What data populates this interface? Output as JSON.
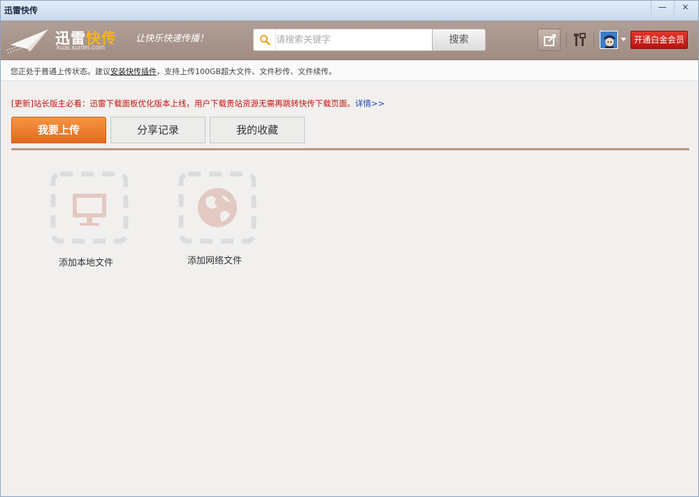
{
  "window": {
    "title": "迅雷快传",
    "minimize": "—",
    "close": "×"
  },
  "header": {
    "logo_main": "迅雷",
    "logo_highlight": "快传",
    "logo_url": "kuai.xunlei.com",
    "slogan": "让快乐快速传播！",
    "search_placeholder": "请搜索关键字",
    "search_button": "搜索",
    "vip_button": "开通白金会员"
  },
  "notice": {
    "prefix": "您正处于普通上传状态。建议",
    "link": "安装快传插件",
    "suffix": "，支持上传100GB超大文件、文件秒传、文件续传。"
  },
  "update": {
    "text": "[更新]站长版主必看：迅雷下载面板优化版本上线，用户下载贵站资源无需再跳转快传下载页面。",
    "link": "详情>>"
  },
  "tabs": [
    {
      "label": "我要上传"
    },
    {
      "label": "分享记录"
    },
    {
      "label": "我的收藏"
    }
  ],
  "uploads": {
    "local": "添加本地文件",
    "web": "添加网络文件"
  },
  "colors": {
    "header_bg": "#a8958c",
    "active_tab": "#ea7a2a",
    "vip": "#c71d15",
    "update_text": "#c3130f"
  }
}
